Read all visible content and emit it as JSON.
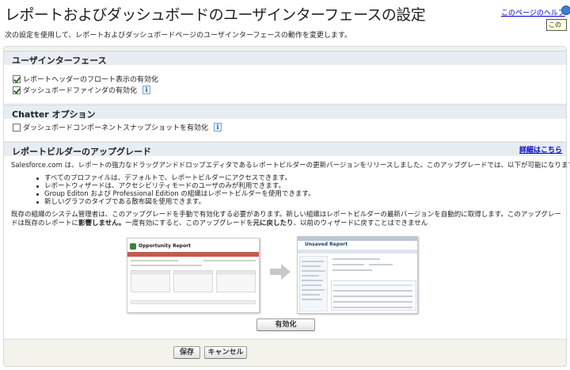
{
  "header": {
    "title": "レポートおよびダッシュボードのユーザインターフェースの設定",
    "help_link": "このページのヘルプ",
    "tooltip": "この",
    "description": "次の設定を使用して、レポートおよびダッシュボードページのユーザインターフェースの動作を変更します。"
  },
  "sections": {
    "ui": {
      "title": "ユーザインターフェース",
      "options": [
        {
          "label": "レポートヘッダーのフロート表示の有効化",
          "checked": true
        },
        {
          "label": "ダッシュボードファインダの有効化",
          "checked": true,
          "info": "i"
        }
      ]
    },
    "chatter": {
      "title": "Chatter オプション",
      "options": [
        {
          "label": "ダッシュボードコンポーネントスナップショットを有効化",
          "checked": false,
          "info": "i"
        }
      ]
    },
    "builder": {
      "title": "レポートビルダーのアップグレード",
      "detail_link": "詳細はこちら",
      "intro": "Salesforce.com は、レポートの強力なドラッグアンドドロップエディタであるレポートビルダーの更新バージョンをリリースしました。このアップグレードでは、以下が可能になります。",
      "bullets": [
        "すべてのプロファイルは、デフォルトで、レポートビルダーにアクセスできます。",
        "レポートウィザードは、アクセシビリティモードのユーザのみが利用できます。",
        "Group Editon および Professional Edition の組織はレポートビルダーを使用できます。",
        "新しいグラフのタイプである散布図を使用できます。"
      ],
      "notice_part1": "既存の組織のシステム管理者は、このアップグレードを手動で有効化する必要があります。新しい組織はレポートビルダーの最新バージョンを自動的に取得します。このアップグレードは既存のレポートに",
      "notice_bold1": "影響しません。",
      "notice_part2": "一度有効にすると、このアップグレードを",
      "notice_bold2": "元に戻したり",
      "notice_part3": "、以前のウィザードに戻すことはできません",
      "preview_old_title": "Opportunity Report",
      "preview_new_title": "Unsaved Report",
      "enable_button": "有効化"
    }
  },
  "footer": {
    "save_button": "保存",
    "cancel_button": "キャンセル"
  },
  "colors": {
    "link": "#0000cc",
    "section_header_bg": "#e7edf2",
    "panel_bg": "#f3f3ec",
    "old_report_bar": "#c35b4d",
    "checkmark": "#2b6e22"
  },
  "icons": [
    "help-icon",
    "info-icon",
    "arrow-right-icon"
  ]
}
